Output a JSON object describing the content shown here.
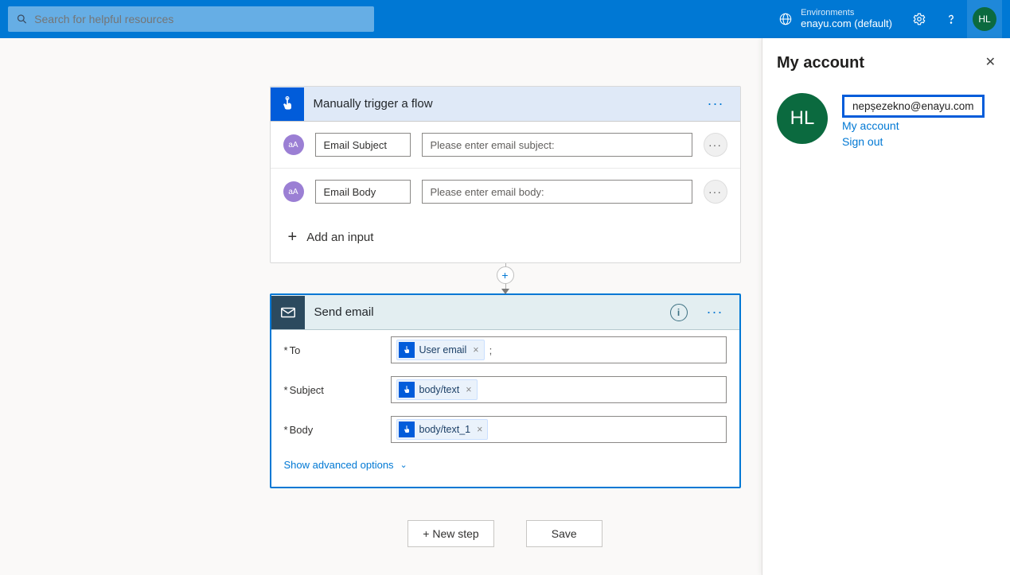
{
  "header": {
    "search_placeholder": "Search for helpful resources",
    "environments_label": "Environments",
    "environments_value": "enayu.com (default)",
    "avatar_initials": "HL"
  },
  "flow": {
    "trigger": {
      "title": "Manually trigger a flow",
      "inputs": [
        {
          "label": "Email Subject",
          "placeholder": "Please enter email subject:"
        },
        {
          "label": "Email Body",
          "placeholder": "Please enter email body:"
        }
      ],
      "add_input_label": "Add an input"
    },
    "action": {
      "title": "Send email",
      "fields": {
        "to_label": "To",
        "subject_label": "Subject",
        "body_label": "Body",
        "tokens": {
          "to": "User email",
          "subject": "body/text",
          "body": "body/text_1"
        }
      },
      "advanced_label": "Show advanced options"
    }
  },
  "buttons": {
    "new_step": "+ New step",
    "save": "Save"
  },
  "panel": {
    "title": "My account",
    "email": "nepșezekno@enayu.com",
    "my_account_link": "My account",
    "sign_out": "Sign out",
    "avatar_initials": "HL"
  }
}
